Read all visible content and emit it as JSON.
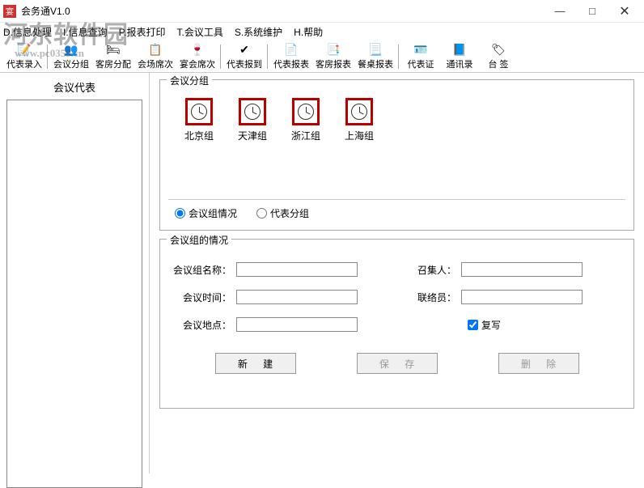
{
  "window": {
    "title": "会务通V1.0",
    "min": "—",
    "max": "□",
    "close": "✕"
  },
  "menu": {
    "m1": "D.信息处理",
    "m2": "I.信息查询",
    "m3": "P.报表打印",
    "m4": "T.会议工具",
    "m5": "S.系统维护",
    "m6": "H.帮助"
  },
  "toolbar": {
    "t1": "代表录入",
    "i1": "📝",
    "t2": "会议分组",
    "i2": "👥",
    "t3": "客房分配",
    "i3": "🛏",
    "t4": "会场席次",
    "i4": "📋",
    "t5": "宴会席次",
    "i5": "🍷",
    "t6": "代表报到",
    "i6": "✔",
    "t7": "代表报表",
    "i7": "📄",
    "t8": "客房报表",
    "i8": "📑",
    "t9": "餐桌报表",
    "i9": "📃",
    "t10": "代表证",
    "i10": "🪪",
    "t11": "通讯录",
    "i11": "📘",
    "t12": "台  签",
    "i12": "🏷"
  },
  "sidebar": {
    "header": "会议代表"
  },
  "groupbox1": {
    "legend": "会议分组",
    "items": [
      {
        "label": "北京组"
      },
      {
        "label": "天津组"
      },
      {
        "label": "浙江组"
      },
      {
        "label": "上海组"
      }
    ],
    "radio1": "会议组情况",
    "radio2": "代表分组"
  },
  "groupbox2": {
    "legend": "会议组的情况",
    "f_name": "会议组名称：",
    "f_time": "会议时间：",
    "f_place": "会议地点：",
    "f_host": "召集人：",
    "f_contact": "联络员：",
    "f_copy": "复写",
    "v_name": "",
    "v_time": "",
    "v_place": "",
    "v_host": "",
    "v_contact": ""
  },
  "buttons": {
    "new": "新  建",
    "save": "保  存",
    "delete": "删  除"
  },
  "watermark": {
    "main": "河东软件园",
    "sub": "www.pc0359.cn"
  }
}
